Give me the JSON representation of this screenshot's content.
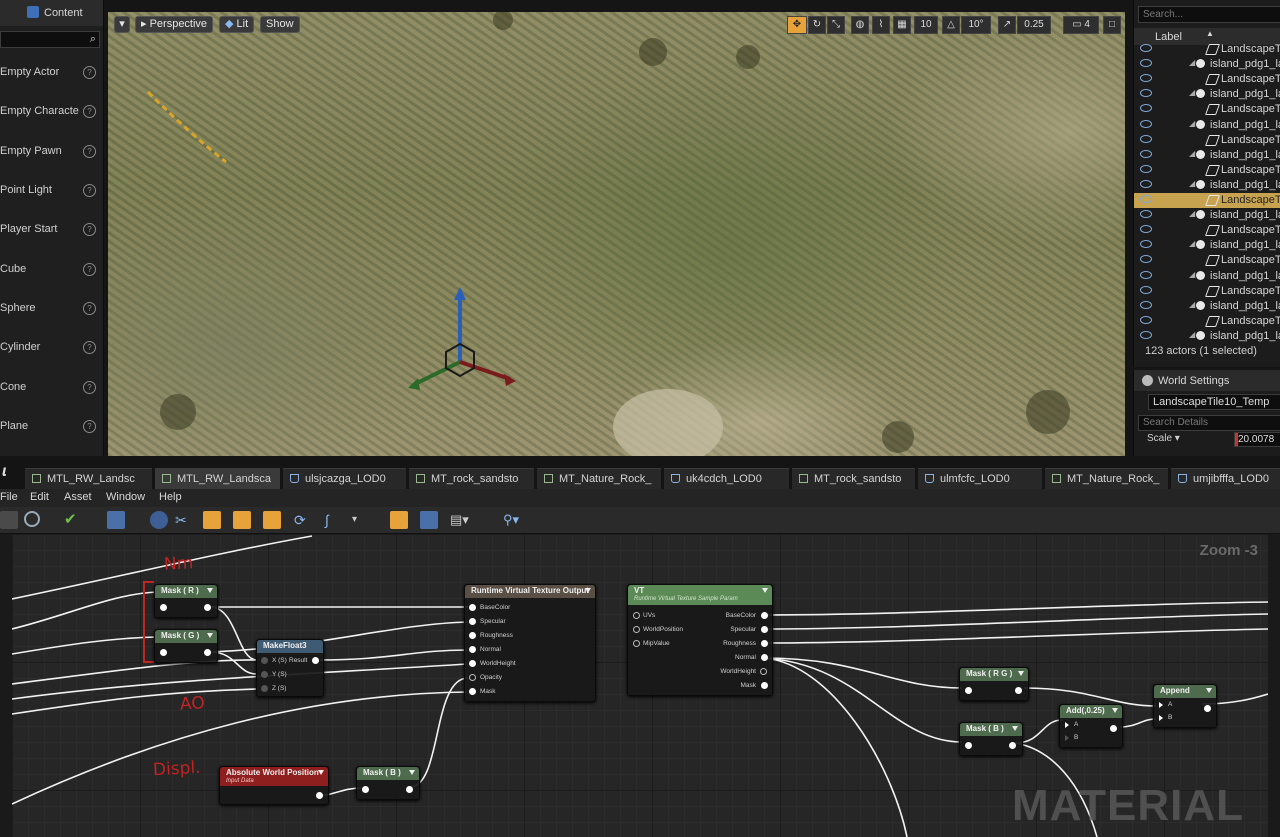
{
  "place_panel": {
    "tab_label": "Content",
    "items": [
      {
        "label": "Empty Actor"
      },
      {
        "label": "Empty Characte"
      },
      {
        "label": "Empty Pawn"
      },
      {
        "label": "Point Light"
      },
      {
        "label": "Player Start"
      },
      {
        "label": "Cube"
      },
      {
        "label": "Sphere"
      },
      {
        "label": "Cylinder"
      },
      {
        "label": "Cone"
      },
      {
        "label": "Plane"
      }
    ]
  },
  "viewport": {
    "perspective_label": "Perspective",
    "lit_label": "Lit",
    "show_label": "Show",
    "grid_snap": "10",
    "rotation_snap": "10°",
    "scale_snap": "0.25",
    "camera_speed": "4"
  },
  "outliner": {
    "search_placeholder": "Search...",
    "column_label": "Label",
    "rows": [
      {
        "label": "LandscapeT",
        "type": "tile",
        "selected": false
      },
      {
        "label": "island_pdg1_la",
        "type": "proxy",
        "selected": false
      },
      {
        "label": "LandscapeT",
        "type": "tile",
        "selected": false
      },
      {
        "label": "island_pdg1_la",
        "type": "proxy",
        "selected": false
      },
      {
        "label": "LandscapeT",
        "type": "tile",
        "selected": false
      },
      {
        "label": "island_pdg1_la",
        "type": "proxy",
        "selected": false
      },
      {
        "label": "LandscapeT",
        "type": "tile",
        "selected": false
      },
      {
        "label": "island_pdg1_la",
        "type": "proxy",
        "selected": false
      },
      {
        "label": "LandscapeT",
        "type": "tile",
        "selected": false
      },
      {
        "label": "island_pdg1_la",
        "type": "proxy",
        "selected": false
      },
      {
        "label": "LandscapeT",
        "type": "tile",
        "selected": true
      },
      {
        "label": "island_pdg1_la",
        "type": "proxy",
        "selected": false
      },
      {
        "label": "LandscapeT",
        "type": "tile",
        "selected": false
      },
      {
        "label": "island_pdg1_la",
        "type": "proxy",
        "selected": false
      },
      {
        "label": "LandscapeT",
        "type": "tile",
        "selected": false
      },
      {
        "label": "island_pdg1_la",
        "type": "proxy",
        "selected": false
      },
      {
        "label": "LandscapeT",
        "type": "tile",
        "selected": false
      },
      {
        "label": "island_pdg1_la",
        "type": "proxy",
        "selected": false
      },
      {
        "label": "LandscapeT",
        "type": "tile",
        "selected": false
      },
      {
        "label": "island_pdg1_la",
        "type": "proxy",
        "selected": false
      }
    ],
    "actor_count": "123 actors (1 selected)"
  },
  "details": {
    "tab_label": "World Settings",
    "actor_name": "LandscapeTile10_Temp",
    "search_placeholder": "Search Details",
    "scale_label": "Scale",
    "scale_value": "20.0078"
  },
  "asset_tabs": [
    {
      "label": "MTL_RW_Landsc",
      "kind": "material",
      "active": false
    },
    {
      "label": "MTL_RW_Landsca",
      "kind": "material",
      "active": true
    },
    {
      "label": "ulsjcazga_LOD0",
      "kind": "mesh",
      "active": false
    },
    {
      "label": "MT_rock_sandsto",
      "kind": "material",
      "active": false
    },
    {
      "label": "MT_Nature_Rock_",
      "kind": "material",
      "active": false
    },
    {
      "label": "uk4cdch_LOD0",
      "kind": "mesh",
      "active": false
    },
    {
      "label": "MT_rock_sandsto",
      "kind": "material",
      "active": false
    },
    {
      "label": "ulmfcfc_LOD0",
      "kind": "mesh",
      "active": false
    },
    {
      "label": "MT_Nature_Rock_",
      "kind": "material",
      "active": false
    },
    {
      "label": "umjibfffa_LOD0",
      "kind": "mesh",
      "active": false
    }
  ],
  "menu": [
    "File",
    "Edit",
    "Asset",
    "Window",
    "Help"
  ],
  "graph": {
    "zoom_label": "Zoom -3",
    "watermark": "MATERIAL",
    "annotations": {
      "nm": "Nm",
      "ao": "AO",
      "displ": "Displ."
    },
    "nodes": {
      "mask_r": "Mask ( R )",
      "mask_g": "Mask ( G )",
      "makefloat3": {
        "title": "MakeFloat3",
        "pins": [
          "X (S)",
          "Y (S)",
          "Z (S)"
        ],
        "out": "Result"
      },
      "rvt_output": {
        "title": "Runtime Virtual Texture Output",
        "pins": [
          "BaseColor",
          "Specular",
          "Roughness",
          "Normal",
          "WorldHeight",
          "Opacity",
          "Mask"
        ]
      },
      "vt": {
        "title": "VT",
        "subtitle": "Runtime Virtual Texture Sample Param",
        "inputs": [
          "UVs",
          "WorldPosition",
          "MipValue"
        ],
        "outputs": [
          "BaseColor",
          "Specular",
          "Roughness",
          "Normal",
          "WorldHeight",
          "Mask"
        ]
      },
      "abs_world_pos": {
        "title": "Absolute World Position",
        "subtitle": "Input Data"
      },
      "mask_b1": "Mask ( B )",
      "mask_rg": "Mask ( R G )",
      "mask_b2": "Mask ( B )",
      "add": {
        "title": "Add(,0.25)",
        "pins": [
          "A",
          "B"
        ]
      },
      "append": {
        "title": "Append",
        "pins": [
          "A",
          "B"
        ]
      }
    }
  },
  "colors": {
    "selection": "#c7a34f",
    "accent_orange": "#e8a23a",
    "node_param_header": "#5c8a57",
    "node_input_header": "#8f1f1f",
    "annotation": "#c22323"
  }
}
